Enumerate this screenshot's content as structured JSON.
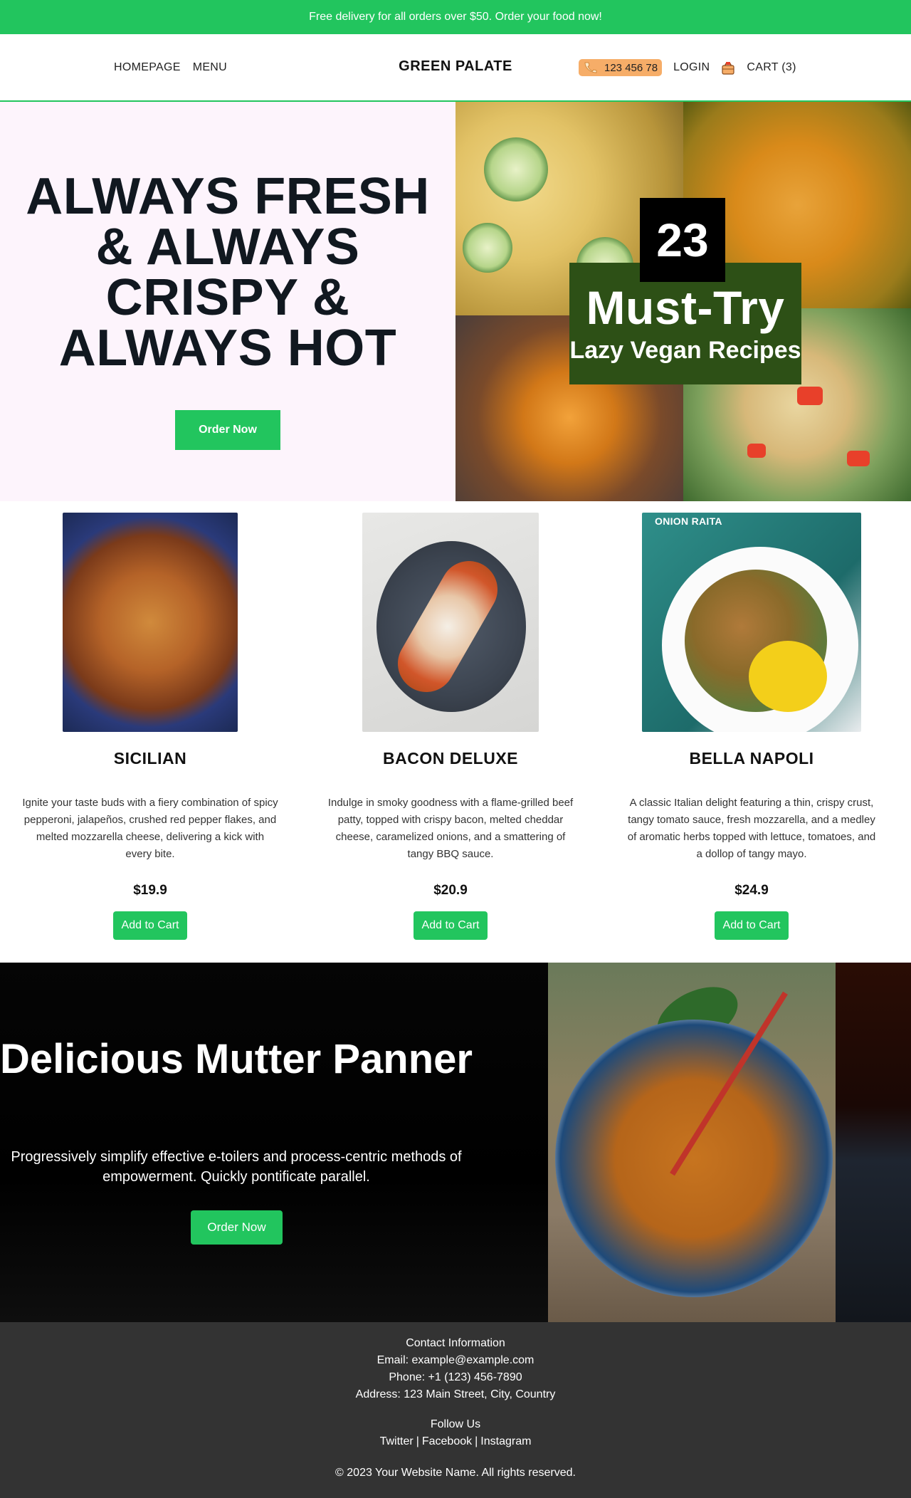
{
  "promo": {
    "text": "Free delivery for all orders over $50. Order your food now!"
  },
  "header": {
    "nav": [
      "HOMEPAGE",
      "MENU"
    ],
    "brand": "GREEN PALATE",
    "phone": "123 456 78",
    "login": "LOGIN",
    "cart": "CART (3)"
  },
  "hero": {
    "title": "ALWAYS FRESH & ALWAYS CRISPY & ALWAYS HOT",
    "button": "Order Now",
    "image": {
      "badge_number": "23",
      "badge_title": "Must-Try",
      "badge_subtitle": "Lazy Vegan Recipes"
    }
  },
  "products": [
    {
      "name": "SICILIAN",
      "description": "Ignite your taste buds with a fiery combination of spicy pepperoni, jalapeños, crushed red pepper flakes, and melted mozzarella cheese, delivering a kick with every bite.",
      "price": "$19.9",
      "button": "Add to Cart"
    },
    {
      "name": "BACON DELUXE",
      "description": "Indulge in smoky goodness with a flame-grilled beef patty, topped with crispy bacon, melted cheddar cheese, caramelized onions, and a smattering of tangy BBQ sauce.",
      "price": "$20.9",
      "button": "Add to Cart"
    },
    {
      "name": "BELLA NAPOLI",
      "description": "A classic Italian delight featuring a thin, crispy crust, tangy tomato sauce, fresh mozzarella, and a medley of aromatic herbs topped with lettuce, tomatoes, and a dollop of tangy mayo.",
      "price": "$24.9",
      "button": "Add to Cart",
      "image_tag": "ONION RAITA"
    }
  ],
  "feature": {
    "title": "Delicious Mutter Panner",
    "subtitle": "Progressively simplify effective e-toilers and process-centric methods of empowerment. Quickly pontificate parallel.",
    "button": "Order Now"
  },
  "footer": {
    "contact_heading": "Contact Information",
    "email": "Email: example@example.com",
    "phone": "Phone: +1 (123) 456-7890",
    "address": "Address: 123 Main Street, City, Country",
    "follow_heading": "Follow Us",
    "links": [
      "Twitter",
      "Facebook",
      "Instagram"
    ],
    "copyright": "© 2023 Your Website Name. All rights reserved."
  },
  "colors": {
    "accent": "#22c55e",
    "hero_bg": "#fdf4fc",
    "footer_bg": "#333333",
    "badge_green": "#2d5016",
    "phone_pill": "#f6ad68"
  }
}
